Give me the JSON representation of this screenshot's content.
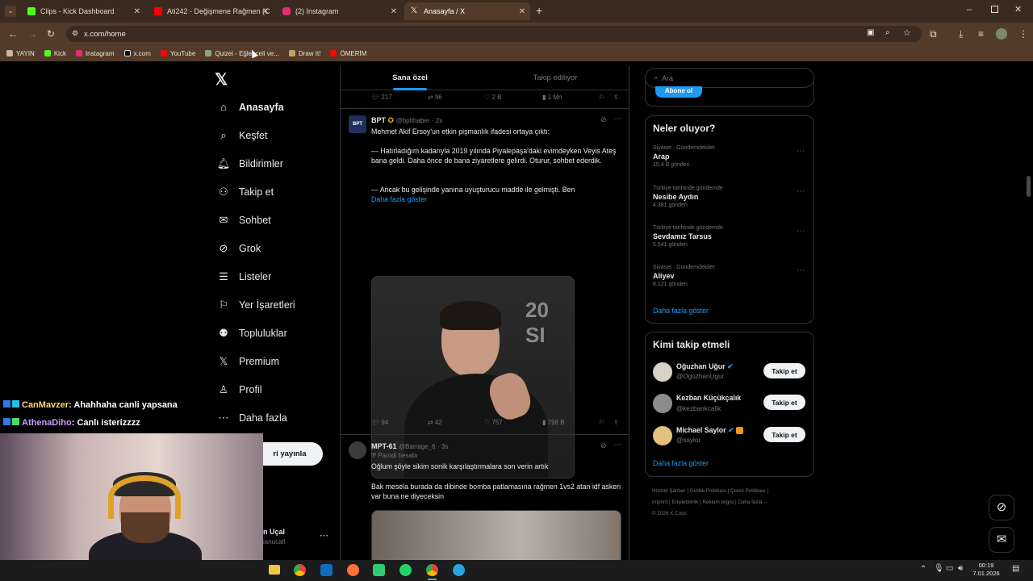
{
  "browser": {
    "tabs": [
      {
        "label": "Clips - Kick Dashboard",
        "color": "#53fc18"
      },
      {
        "label": "Ati242 - Değişmene Rağmen (C",
        "color": "#ff0000"
      },
      {
        "label": "(2) Instagram",
        "color": "#e1306c"
      },
      {
        "label": "Anasayfa / X",
        "color": "#ffffff"
      }
    ],
    "url": "x.com/home",
    "bookmarks": [
      {
        "label": "YAYIN",
        "icon": "folder-icon"
      },
      {
        "label": "Kick",
        "icon": "kick-icon"
      },
      {
        "label": "Instagram",
        "icon": "instagram-icon"
      },
      {
        "label": "x.com",
        "icon": "x-icon"
      },
      {
        "label": "YouTube",
        "icon": "youtube-icon"
      },
      {
        "label": "Quizei - Eğlenceli ve...",
        "icon": "quiz-icon"
      },
      {
        "label": "Draw It!",
        "icon": "draw-icon"
      },
      {
        "label": "ÖMERİM",
        "icon": "youtube-icon"
      }
    ]
  },
  "nav": {
    "items": [
      {
        "label": "Anasayfa",
        "icon": "home-icon"
      },
      {
        "label": "Keşfet",
        "icon": "search-icon"
      },
      {
        "label": "Bildirimler",
        "icon": "bell-icon"
      },
      {
        "label": "Takip et",
        "icon": "person-add-icon"
      },
      {
        "label": "Sohbet",
        "icon": "mail-icon"
      },
      {
        "label": "Grok",
        "icon": "grok-icon"
      },
      {
        "label": "Listeler",
        "icon": "list-icon"
      },
      {
        "label": "Yer İşaretleri",
        "icon": "bookmark-icon"
      },
      {
        "label": "Topluluklar",
        "icon": "communities-icon"
      },
      {
        "label": "Premium",
        "icon": "x-icon"
      },
      {
        "label": "Profil",
        "icon": "profile-icon"
      },
      {
        "label": "Daha fazla",
        "icon": "more-icon"
      }
    ],
    "post_button": "ri yayınla",
    "account_name": "n Uçal",
    "account_handle": "ianucall"
  },
  "feed": {
    "tab_foryou": "Sana özel",
    "tab_following": "Takip ediliyor",
    "prev_stats": {
      "replies": "217",
      "reposts": "96",
      "likes": "2 B",
      "views": "1 Mn"
    },
    "tweet1": {
      "author": "BPT",
      "handle": "@bptthaber",
      "time": "· 2s",
      "avatar_text": "BPT",
      "line1": "Mehmet Akif Ersoy'un etkin pişmanlık ifadesi ortaya çıktı:",
      "para2": "— Hatırladığım kadarıyla 2019 yılında Piyalepaşa'daki evimdeyken Veyis Ateş bana geldi. Daha önce de bana ziyaretlere gelirdi. Oturur, sohbet ederdik.",
      "para3": "— Ancak bu gelişinde yanına uyuşturucu madde ile gelmişti. Ben",
      "show_more": "Daha fazla göster",
      "image_text": "20 SI",
      "stats": {
        "replies": "94",
        "reposts": "42",
        "likes": "757",
        "views": "798 B"
      }
    },
    "tweet2": {
      "author": "MPT-61",
      "handle": "@Barrage_6",
      "time": "· 3s",
      "parody": "Parodi hesabı",
      "line1": "Oğlum şöyle sikim sonik karşılaştırmalara son verin artık",
      "line2": "Bak mesela burada da dibinde bomba patlamasına rağmen 1vs2 atan idf askeri var buna ne diyeceksin"
    }
  },
  "right": {
    "search_placeholder": "Ara",
    "subscribe_label": "Abone ol",
    "trends_title": "Neler oluyor?",
    "trends": [
      {
        "category": "Siyaset · Gündemdekiler",
        "name": "Arap",
        "count": "15,4 B gönderi"
      },
      {
        "category": "Türkiye tarihinde gündemde",
        "name": "Nesibe Aydın",
        "count": "4.381 gönderi"
      },
      {
        "category": "Türkiye tarihinde gündemde",
        "name": "Sevdamız Tarsus",
        "count": "5.541 gönderi"
      },
      {
        "category": "Siyaset · Gündemdekiler",
        "name": "Aliyev",
        "count": "8.121 gönderi"
      }
    ],
    "trends_more": "Daha fazla göster",
    "wtf_title": "Kimi takip etmeli",
    "who_to_follow": [
      {
        "name": "Oğuzhan Uğur",
        "handle": "@OguzhanUgur"
      },
      {
        "name": "Kezban Küçükçalık",
        "handle": "@kezbankcalik"
      },
      {
        "name": "Michael Saylor",
        "handle": "@saylor"
      }
    ],
    "follow_label": "Takip et",
    "wtf_more": "Daha fazla göster",
    "footer_line1": "Hizmet Şartları | Gizlilik Politikası | Çerez Politikası |",
    "footer_line2": "Imprint | Erişilebilirlik | Reklam bilgisi | Daha fazla ···",
    "footer_line3": "© 2026 X Corp."
  },
  "chat": [
    {
      "user": "CanMavzer",
      "text": ": Ahahhaha canli yapsana",
      "color": "#ffd37a"
    },
    {
      "user": "AthenaDiho",
      "text": ": Canlı isterizzzz",
      "color": "#c9a0ff"
    }
  ],
  "taskbar": {
    "time": "00:19",
    "date": "7.01.2026"
  }
}
